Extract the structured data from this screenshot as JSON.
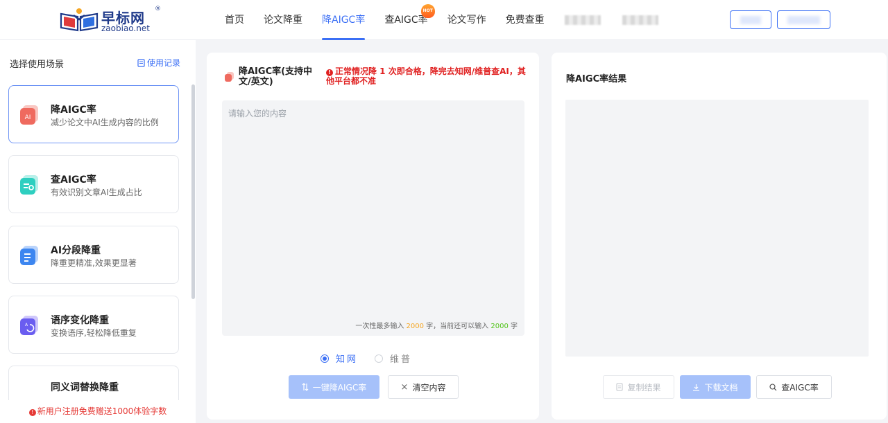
{
  "brand": {
    "name_cn": "早标网",
    "reg": "®",
    "domain": "zaobiao.net",
    "color": "#1f3a8a"
  },
  "nav": {
    "items": [
      {
        "label": "首页",
        "active": false
      },
      {
        "label": "论文降重",
        "active": false
      },
      {
        "label": "降AIGC率",
        "active": true
      },
      {
        "label": "查AIGC率",
        "active": false,
        "badge": "HOT"
      },
      {
        "label": "论文写作",
        "active": false
      },
      {
        "label": "免费查重",
        "active": false
      }
    ],
    "accent": "#3b6ff5"
  },
  "sidebar": {
    "title": "选择使用场景",
    "record_link": "使用记录",
    "scenes": [
      {
        "name": "降AIGC率",
        "desc": "减少论文中AI生成内容的比例",
        "icon": "ai-reduce-icon",
        "active": true
      },
      {
        "name": "查AIGC率",
        "desc": "有效识别文章AI生成占比",
        "icon": "ai-detect-icon",
        "active": false
      },
      {
        "name": "AI分段降重",
        "desc": "降重更精准,效果更显著",
        "icon": "document-icon",
        "active": false
      },
      {
        "name": "语序变化降重",
        "desc": "变换语序,轻松降低重复",
        "icon": "reorder-icon",
        "active": false
      },
      {
        "name": "同义词替换降重",
        "desc": "",
        "icon": "synonym-icon",
        "active": false
      }
    ],
    "promo": "新用户注册免费赠送1000体验字数"
  },
  "input_panel": {
    "title": "降AIGC率(支持中文/英文)",
    "warning": "正常情况降 1 次即合格，降完去知网/维普查AI，其他平台都不准",
    "placeholder": "请输入您的内容",
    "count_prefix": "一次性最多输入",
    "max_chars": "2000",
    "count_mid": "字，当前还可以输入",
    "remaining_chars": "2000",
    "count_suffix": "字",
    "options": [
      {
        "label": "知网",
        "selected": true
      },
      {
        "label": "维普",
        "selected": false
      }
    ],
    "submit_label": "一键降AIGC率",
    "clear_label": "清空内容"
  },
  "result_panel": {
    "title": "降AIGC率结果",
    "copy_label": "复制结果",
    "download_label": "下载文档",
    "check_label": "查AIGC率"
  }
}
